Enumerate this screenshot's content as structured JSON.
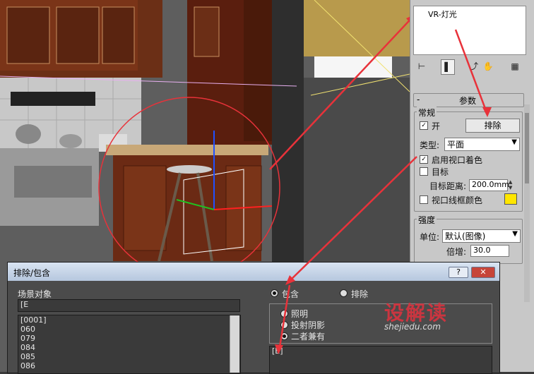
{
  "light_name": "VR-灯光",
  "toolbar_tabs": [
    "create-tab",
    "modify-tab",
    "hierarchy-tab",
    "motion-tab",
    "display-tab",
    "utilities-tab"
  ],
  "rollout": {
    "collapse_symbol": "-",
    "title": "参数",
    "general": {
      "title": "常规",
      "on_label": "开",
      "on_checked": true,
      "exclude_label": "排除",
      "type_label": "类型:",
      "type_value": "平面",
      "viewport_shading_label": "启用视口着色",
      "viewport_shading_checked": true,
      "target_label": "目标",
      "target_checked": false,
      "target_distance_label": "目标距离:",
      "target_distance_value": "200.0mm",
      "wire_color_label": "视口线框颜色",
      "wire_color_checked": false,
      "wire_color": "#ffe600"
    },
    "intensity": {
      "title": "强度",
      "unit_label": "单位:",
      "unit_value": "默认(图像)",
      "multiplier_label": "倍增:",
      "multiplier_value": "30.0"
    }
  },
  "dialog": {
    "title": "排除/包含",
    "help_button": "?",
    "close_button": "✕",
    "scene_objects_label": "场景对象",
    "search_value": "[E",
    "objects": [
      "[0001]",
      "060",
      "079",
      "084",
      "085",
      "086"
    ],
    "include_label": "包含",
    "exclude_label": "排除",
    "mode": "include",
    "options": [
      {
        "label": "照明",
        "checked": false
      },
      {
        "label": "投射阴影",
        "checked": false
      },
      {
        "label": "二者兼有",
        "checked": true
      }
    ],
    "included_items": [
      "[E]"
    ]
  },
  "watermark": {
    "text": "设解读",
    "url": "shejiedu.com"
  },
  "colors": {
    "arrow": "#e8323a",
    "highlight": "#e8323a",
    "panel": "#c8c8c8"
  }
}
